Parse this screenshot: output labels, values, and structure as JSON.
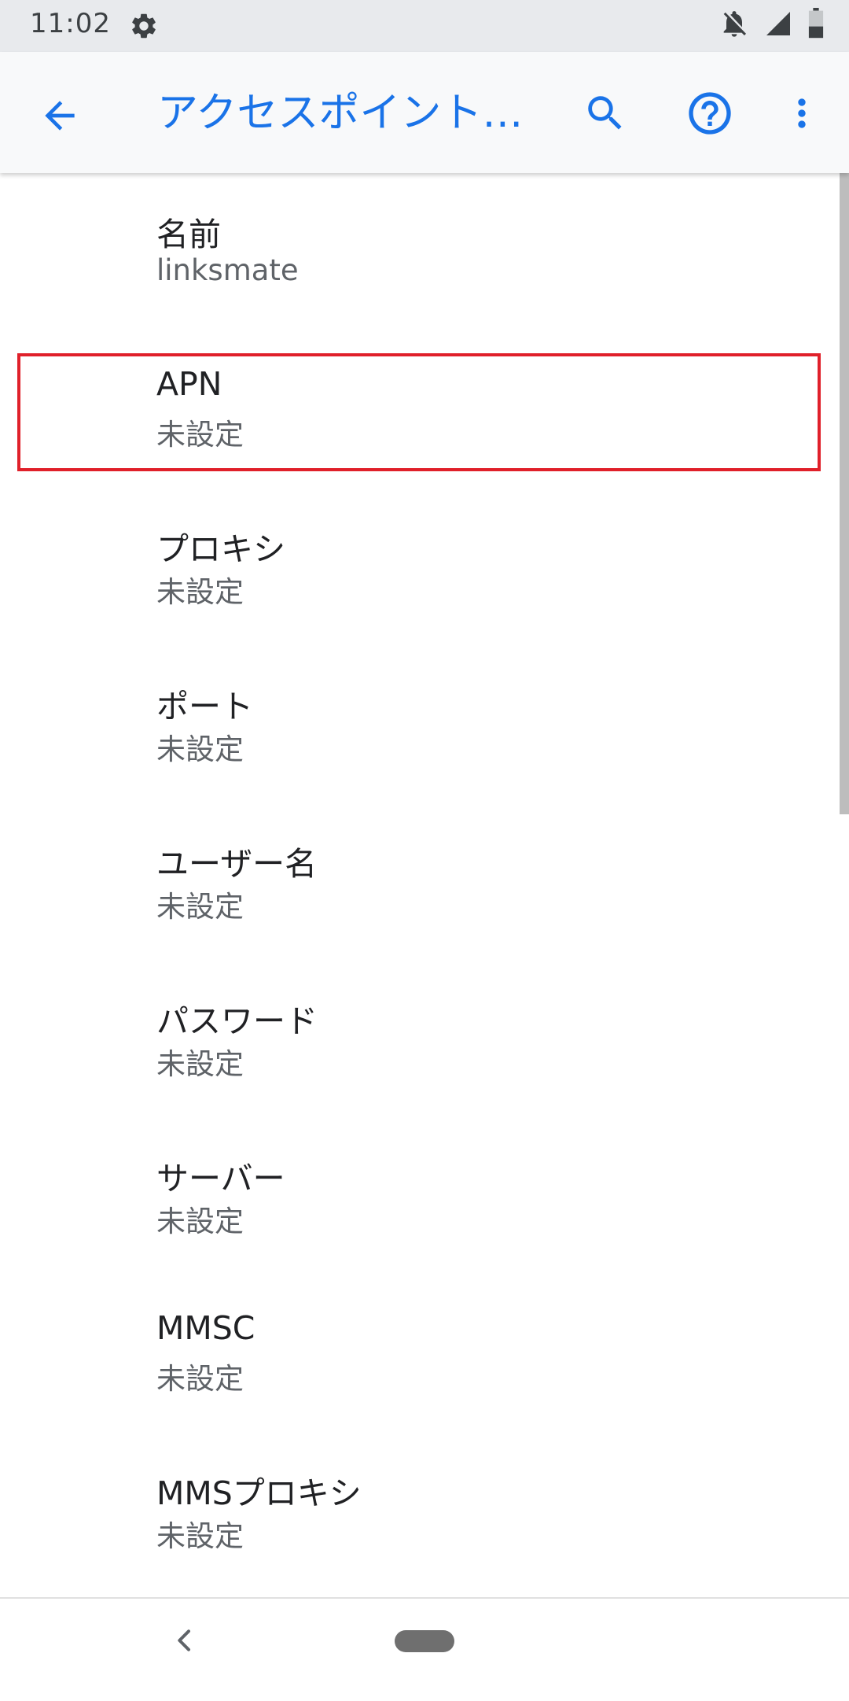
{
  "status_bar": {
    "time": "11:02",
    "icons": [
      "settings-gear-icon",
      "notifications-off-icon",
      "signal-icon",
      "battery-icon"
    ]
  },
  "app_bar": {
    "title": "アクセスポイント…",
    "back_icon": "arrow-back-icon",
    "actions": [
      "search-icon",
      "help-icon",
      "more-vert-icon"
    ],
    "accent_color": "#1a73e8"
  },
  "preferences": [
    {
      "title": "名前",
      "summary": "linksmate"
    },
    {
      "title": "APN",
      "summary": "未設定"
    },
    {
      "title": "プロキシ",
      "summary": "未設定"
    },
    {
      "title": "ポート",
      "summary": "未設定"
    },
    {
      "title": "ユーザー名",
      "summary": "未設定"
    },
    {
      "title": "パスワード",
      "summary": "未設定"
    },
    {
      "title": "サーバー",
      "summary": "未設定"
    },
    {
      "title": "MMSC",
      "summary": "未設定"
    },
    {
      "title": "MMSプロキシ",
      "summary": "未設定"
    }
  ],
  "highlight": {
    "target": "APN",
    "color": "#e0202a"
  },
  "nav_bar": {
    "back_icon": "chevron-left-icon",
    "home_icon": "home-pill-icon"
  }
}
